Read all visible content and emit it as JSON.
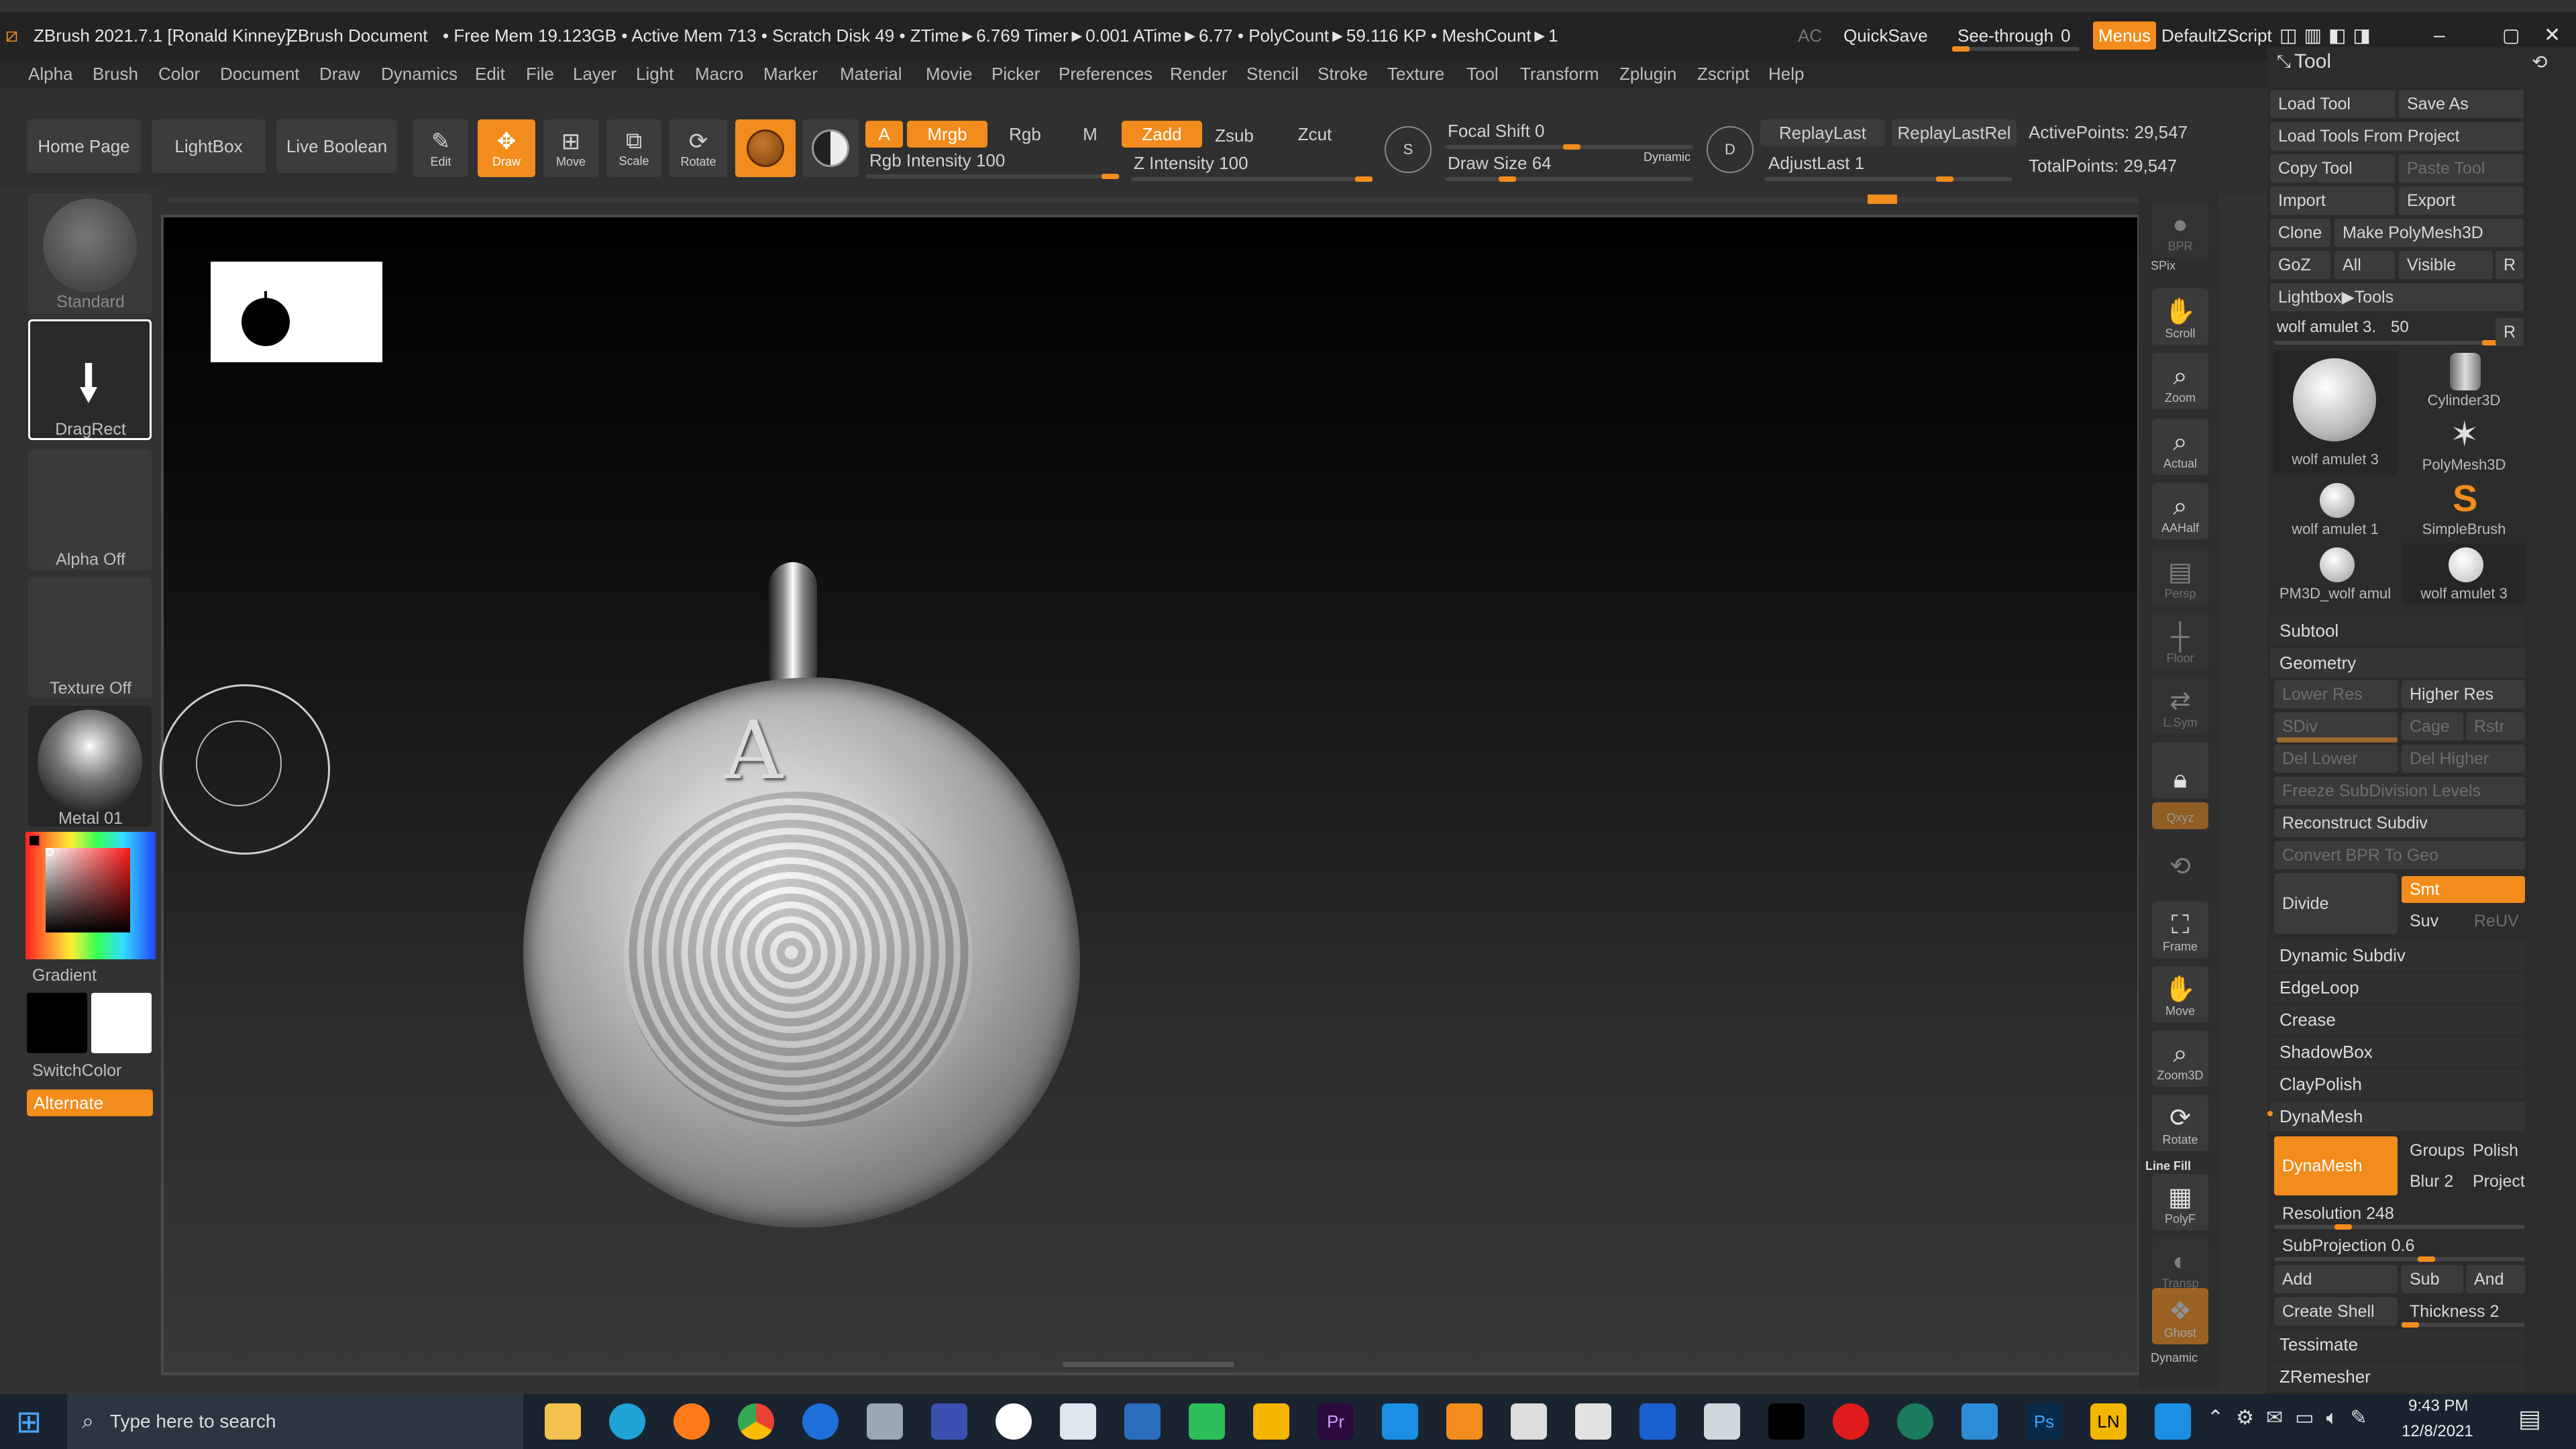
{
  "title_bar": {
    "app_title": "ZBrush 2021.7.1 [Ronald Kinney]",
    "doc": "ZBrush Document",
    "stats": "• Free Mem 19.123GB • Active Mem 713 • Scratch Disk 49 • ZTime►6.769 Timer►0.001 ATime►6.77 • PolyCount►59.116 KP • MeshCount►1",
    "ac": "AC",
    "quicksave": "QuickSave",
    "seethrough": "See-through",
    "seethrough_val": "0",
    "menus": "Menus",
    "script": "DefaultZScript"
  },
  "menu": [
    "Alpha",
    "Brush",
    "Color",
    "Document",
    "Draw",
    "Dynamics",
    "Edit",
    "File",
    "Layer",
    "Light",
    "Macro",
    "Marker",
    "Material",
    "Movie",
    "Picker",
    "Preferences",
    "Render",
    "Stencil",
    "Stroke",
    "Texture",
    "Tool",
    "Transform",
    "Zplugin",
    "Zscript",
    "Help"
  ],
  "shelf": {
    "home": "Home Page",
    "lightbox": "LightBox",
    "liveboolean": "Live Boolean",
    "edit": "Edit",
    "draw": "Draw",
    "move": "Move",
    "scale": "Scale",
    "rotate": "Rotate",
    "a": "A",
    "mrgb": "Mrgb",
    "rgb": "Rgb",
    "m": "M",
    "zadd": "Zadd",
    "zsub": "Zsub",
    "zcut": "Zcut",
    "rgb_intensity": "Rgb Intensity 100",
    "z_intensity": "Z Intensity 100",
    "focal_shift": "Focal Shift 0",
    "draw_size": "Draw Size 64",
    "dynamic": "Dynamic",
    "replay_last": "ReplayLast",
    "replay_last_rel": "ReplayLastRel",
    "adjust_last": "AdjustLast 1",
    "active_points": "ActivePoints: 29,547",
    "total_points": "TotalPoints: 29,547"
  },
  "left": {
    "brush": "Standard",
    "stroke": "DragRect",
    "alpha": "Alpha Off",
    "texture": "Texture Off",
    "material": "Metal 01",
    "gradient": "Gradient",
    "switch": "SwitchColor",
    "alternate": "Alternate"
  },
  "dock": {
    "bpr": "BPR",
    "spix": "SPix",
    "scroll": "Scroll",
    "zoom": "Zoom",
    "actual": "Actual",
    "aahalf": "AAHalf",
    "persp": "Persp",
    "floor": "Floor",
    "lsym": "L.Sym",
    "xyz": "Qxyz",
    "frame": "Frame",
    "move": "Move",
    "zoom3d": "Zoom3D",
    "rotate": "Rotate",
    "linefill": "Line Fill",
    "polyf": "PolyF",
    "transp": "Transp",
    "ghost": "Ghost",
    "dynamic": "Dynamic"
  },
  "tool": {
    "title": "Tool",
    "load_tool": "Load Tool",
    "save_as": "Save As",
    "load_from_project": "Load Tools From Project",
    "copy_tool": "Copy Tool",
    "paste_tool": "Paste Tool",
    "import": "Import",
    "export": "Export",
    "clone": "Clone",
    "make_polymesh": "Make PolyMesh3D",
    "goz": "GoZ",
    "all": "All",
    "visible": "Visible",
    "r": "R",
    "lightbox_tools": "Lightbox▶Tools",
    "current_tool": "wolf amulet 3.",
    "current_tool_val": "50",
    "thumbs": [
      "wolf amulet 3",
      "Cylinder3D",
      "PolyMesh3D",
      "wolf amulet 1",
      "SimpleBrush",
      "PM3D_wolf amul",
      "wolf amulet 3"
    ],
    "subtool": "Subtool",
    "geometry": "Geometry",
    "lower_res": "Lower Res",
    "higher_res": "Higher Res",
    "sdiv": "SDiv",
    "cage": "Cage",
    "rstr": "Rstr",
    "del_lower": "Del Lower",
    "del_higher": "Del Higher",
    "freeze": "Freeze SubDivision Levels",
    "reconstruct": "Reconstruct Subdiv",
    "convert_bpr": "Convert BPR To Geo",
    "divide": "Divide",
    "smt": "Smt",
    "suv": "Suv",
    "reuv": "ReUV",
    "dynamic_subdiv": "Dynamic Subdiv",
    "edgeloop": "EdgeLoop",
    "crease": "Crease",
    "shadowbox": "ShadowBox",
    "claypolish": "ClayPolish",
    "dynamesh_header": "DynaMesh",
    "dynamesh_btn": "DynaMesh",
    "groups": "Groups",
    "polish": "Polish",
    "blur": "Blur 2",
    "project": "Project",
    "resolution": "Resolution 248",
    "subprojection": "SubProjection 0.6",
    "add": "Add",
    "sub": "Sub",
    "and": "And",
    "create_shell": "Create Shell",
    "thickness": "Thickness 2",
    "tessimate": "Tessimate",
    "zremesher": "ZRemesher"
  },
  "taskbar": {
    "search": "Type here to search",
    "time": "9:43 PM",
    "date": "12/8/2021"
  },
  "colors": {
    "accent": "#f28c1c",
    "bg": "#323232"
  }
}
